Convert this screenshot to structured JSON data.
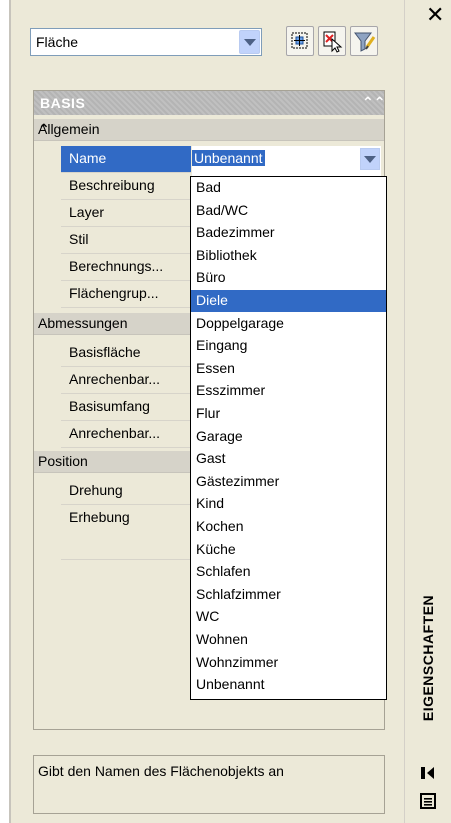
{
  "window": {
    "title": "EIGENSCHAFTEN",
    "close_glyph": "✕"
  },
  "toolbar": {
    "object_type_value": "Fläche",
    "buttons": [
      "select-objects-icon",
      "quick-select-icon",
      "filter-icon"
    ]
  },
  "grid": {
    "section_title": "BASIS",
    "section_collapse_glyph": "⌃⌃",
    "categories": [
      {
        "title": "Allgemein",
        "properties": [
          "Name",
          "Beschreibung",
          "Layer",
          "Stil",
          "Berechnungs...",
          "Flächengrup..."
        ]
      },
      {
        "title": "Abmessungen",
        "properties": [
          "Basisfläche",
          "Anrechenbar...",
          "Basisumfang",
          "Anrechenbar..."
        ]
      },
      {
        "title": "Position",
        "properties": [
          "Drehung",
          "Erhebung"
        ]
      }
    ],
    "name_value": "Unbenannt",
    "cat_toggle_glyph": "⌃"
  },
  "dropdown": {
    "items": [
      "Bad",
      "Bad/WC",
      "Badezimmer",
      "Bibliothek",
      "Büro",
      "Diele",
      "Doppelgarage",
      "Eingang",
      "Essen",
      "Esszimmer",
      "Flur",
      "Garage",
      "Gast",
      "Gästezimmer",
      "Kind",
      "Kochen",
      "Küche",
      "Schlafen",
      "Schlafzimmer",
      "WC",
      "Wohnen",
      "Wohnzimmer",
      "Unbenannt"
    ],
    "highlighted_index": 5
  },
  "description": "Gibt den Namen des Flächenobjekts an",
  "colors": {
    "selection": "#316ac5",
    "panel": "#ece9d8"
  }
}
